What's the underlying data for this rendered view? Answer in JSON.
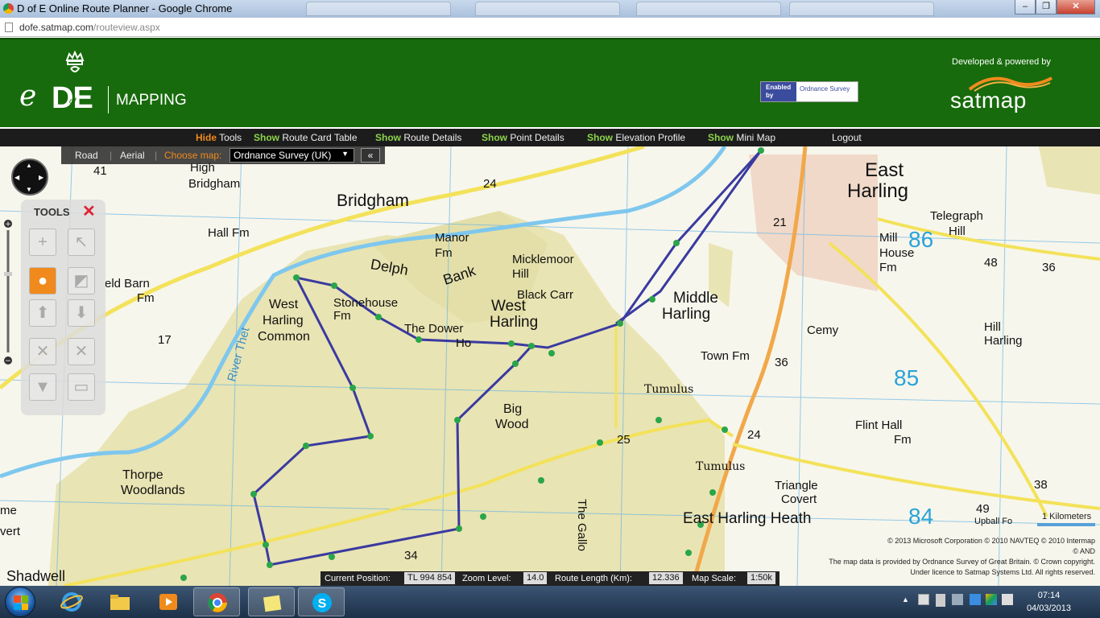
{
  "window": {
    "title": "D of E Online Route Planner - Google Chrome",
    "url_host": "dofe.satmap.com",
    "url_path": "/routeview.aspx"
  },
  "header": {
    "logo_e": "e",
    "logo_de": "DE",
    "logo_of": "of",
    "logo_mapping": "MAPPING",
    "enabled_by": "Enabled by",
    "ordnance_survey": "Ordnance Survey",
    "developed_by": "Developed & powered by",
    "satmap": "satmap"
  },
  "toolbar": [
    {
      "action": "Hide",
      "label": "Tools"
    },
    {
      "action": "Show",
      "label": "Route Card Table"
    },
    {
      "action": "Show",
      "label": "Route Details"
    },
    {
      "action": "Show",
      "label": "Point Details"
    },
    {
      "action": "Show",
      "label": "Elevation Profile"
    },
    {
      "action": "Show",
      "label": "Mini Map"
    },
    {
      "action": "",
      "label": "Logout"
    }
  ],
  "map_mode": {
    "road": "Road",
    "aerial": "Aerial",
    "choose_map": "Choose map:",
    "selected_map": "Ordnance Survey (UK)",
    "collapse": "«"
  },
  "tools_panel": {
    "title": "TOOLS",
    "close": "✕"
  },
  "map_labels": [
    "East",
    "Harling",
    "Telegraph",
    "Hill",
    "Mill",
    "House",
    "Fm",
    "Bridgham",
    "High",
    "Bridgham",
    "Hall Fm",
    "Manor",
    "Fm",
    "Delph",
    "Bank",
    "Micklemoor",
    "Hill",
    "Black Carr",
    "West",
    "Harling",
    "Middle",
    "Harling",
    "eld Barn",
    "Fm",
    "West",
    "Harling",
    "Common",
    "Stonehouse",
    "Fm",
    "The Dower",
    "Ho",
    "River Thet",
    "Cemy",
    "Hill",
    "Harling",
    "Town Fm",
    "Tumulus",
    "Big",
    "Wood",
    "Flint Hall",
    "Fm",
    "Thorpe",
    "Woodlands",
    "Tumulus",
    "Triangle",
    "Covert",
    "East Harling Heath",
    "The Gallo",
    "Shadwell",
    "me",
    "vert",
    "Upball Fo"
  ],
  "map_numbers": [
    "41",
    "24",
    "21",
    "86",
    "48",
    "36",
    "17",
    "36",
    "85",
    "25",
    "24",
    "38",
    "84",
    "49",
    "34"
  ],
  "credits": [
    "© 2013 Microsoft Corporation   © 2010 NAVTEQ   © 2010 Intermap",
    "© AND",
    "The map data is provided by Ordnance Survey of Great Britain. © Crown copyright.",
    "Under licence to Satmap Systems Ltd. All rights reserved."
  ],
  "scale": "1 Kilometers",
  "status": {
    "current_position_label": "Current Position:",
    "current_position": "TL 994 854",
    "zoom_label": "Zoom Level:",
    "zoom": "14.0",
    "route_length_label": "Route Length (Km):",
    "route_length": "12.336",
    "map_scale_label": "Map Scale:",
    "map_scale": "1:50k"
  },
  "clock": {
    "time": "07:14",
    "date": "04/03/2013"
  },
  "colors": {
    "header_green": "#176b0c",
    "route": "#3a3aa0",
    "woodland": "#e8e3b4",
    "grid": "#6ab6e6",
    "satmap_orange": "#f08a1c"
  }
}
